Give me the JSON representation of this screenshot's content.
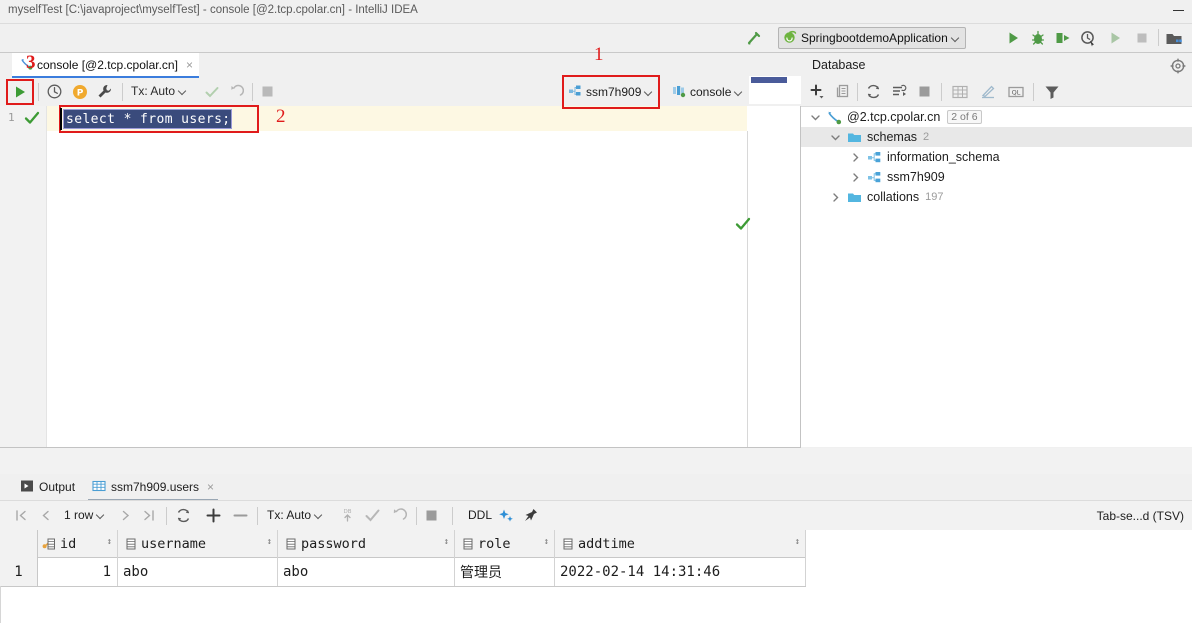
{
  "window": {
    "title": "myselfTest [C:\\javaproject\\myselfTest] - console [@2.tcp.cpolar.cn] - IntelliJ IDEA",
    "minimize_label": "minimize"
  },
  "main_toolbar": {
    "build_icon": "hammer-icon",
    "run_config": {
      "name": "SpringbootdemoApplication",
      "icon": "spring-boot-icon",
      "chevron": "chevron-down-icon"
    },
    "actions": [
      {
        "name": "run-button",
        "icon": "play-icon"
      },
      {
        "name": "debug-button",
        "icon": "bug-icon"
      },
      {
        "name": "run-with-coverage-button",
        "icon": "coverage-icon"
      },
      {
        "name": "profile-button",
        "icon": "profiler-icon"
      },
      {
        "name": "run-disabled-button",
        "icon": "play-gray-icon"
      },
      {
        "name": "stop-button",
        "icon": "stop-icon"
      },
      {
        "name": "project-structure-button",
        "icon": "modules-icon"
      }
    ]
  },
  "console_tab": {
    "label": "console [@2.tcp.cpolar.cn]",
    "close": "×",
    "icon": "console-connection-icon"
  },
  "editor_toolbar": {
    "run_icon": "play-icon",
    "history_icon": "clock-icon",
    "params_icon": "p-badge-icon",
    "settings_icon": "wrench-icon",
    "tx_label": "Tx: Auto",
    "tx_chevron": "chevron-down-icon",
    "commit_icon": "check-icon",
    "rollback_icon": "rollback-icon",
    "stop_icon": "stop-icon"
  },
  "selectors": {
    "schema": {
      "label": "ssm7h909",
      "icon": "schema-icon",
      "chevron": "chevron-down-icon"
    },
    "session": {
      "label": "console",
      "icon": "session-icon",
      "chevron": "chevron-down-icon"
    }
  },
  "annotations": [
    {
      "id": "ann-1",
      "text": "1"
    },
    {
      "id": "ann-2",
      "text": "2"
    },
    {
      "id": "ann-3",
      "text": "3"
    }
  ],
  "editor": {
    "line_number": "1",
    "sql": "select * from users;",
    "inspection_icon": "check-green-icon",
    "gutter_icon": "check-green-icon"
  },
  "database_panel": {
    "title": "Database",
    "settings_icon": "settings-target-icon",
    "toolbar": [
      {
        "name": "add-datasource-button",
        "icon": "plus-icon"
      },
      {
        "name": "duplicate-button",
        "icon": "copy-icon"
      },
      {
        "name": "refresh-button",
        "icon": "refresh-icon"
      },
      {
        "name": "sync-button",
        "icon": "sync-icon"
      },
      {
        "name": "stop-button",
        "icon": "stop-icon"
      },
      {
        "name": "table-editor-button",
        "icon": "table-icon"
      },
      {
        "name": "modify-button",
        "icon": "pencil-icon"
      },
      {
        "name": "query-console-button",
        "icon": "ql-icon"
      },
      {
        "name": "filter-button",
        "icon": "funnel-icon"
      }
    ],
    "tree": [
      {
        "label": "@2.tcp.cpolar.cn",
        "badge": "2 of 6",
        "indent": 0,
        "expanded": true,
        "icon": "datasource-icon",
        "selected": false,
        "count": ""
      },
      {
        "label": "schemas",
        "badge": "",
        "indent": 1,
        "expanded": true,
        "icon": "folder-icon",
        "selected": true,
        "count": "2"
      },
      {
        "label": "information_schema",
        "badge": "",
        "indent": 2,
        "expanded": false,
        "icon": "schema-icon",
        "selected": false,
        "count": ""
      },
      {
        "label": "ssm7h909",
        "badge": "",
        "indent": 2,
        "expanded": false,
        "icon": "schema-icon",
        "selected": false,
        "count": ""
      },
      {
        "label": "collations",
        "badge": "",
        "indent": 1,
        "expanded": false,
        "icon": "folder-icon",
        "selected": false,
        "count": "197"
      }
    ]
  },
  "output": {
    "tabs": [
      {
        "label": "Output",
        "icon": "output-icon",
        "active": false,
        "closable": false
      },
      {
        "label": "ssm7h909.users",
        "icon": "table-icon",
        "active": true,
        "closable": true
      }
    ],
    "close": "×",
    "toolbar": {
      "first_icon": "first-page-icon",
      "prev_icon": "prev-page-icon",
      "rows_label": "1 row",
      "rows_chevron": "chevron-down-icon",
      "next_icon": "next-page-icon",
      "last_icon": "last-page-icon",
      "reload_icon": "refresh-icon",
      "add_row_icon": "plus-icon",
      "delete_row_icon": "minus-icon",
      "tx_label": "Tx: Auto",
      "tx_chevron": "chevron-down-icon",
      "submit_icon": "db-upload-icon",
      "commit_icon": "check-icon",
      "rollback_icon": "rollback-icon",
      "stop_icon": "stop-icon",
      "ddl_label": "DDL",
      "magic_icon": "sparkle-icon",
      "pin_icon": "pin-icon",
      "format_label": "Tab-se...d (TSV)"
    }
  },
  "result_grid": {
    "columns": [
      {
        "label": "id",
        "icon": "key-column-icon",
        "align": "right"
      },
      {
        "label": "username",
        "icon": "column-icon",
        "align": "left"
      },
      {
        "label": "password",
        "icon": "column-icon",
        "align": "left"
      },
      {
        "label": "role",
        "icon": "column-icon",
        "align": "left"
      },
      {
        "label": "addtime",
        "icon": "column-icon",
        "align": "left"
      }
    ],
    "rows": [
      {
        "num": "1",
        "id": "1",
        "username": "abo",
        "password": "abo",
        "role": "管理员",
        "addtime": "2022-02-14 14:31:46"
      }
    ]
  },
  "colors": {
    "accent_blue": "#3b7ddd",
    "annotation_red": "#e01b1b",
    "green": "#3d9b35",
    "selection": "#3a4b7c",
    "current_line": "#fdf8e3"
  }
}
